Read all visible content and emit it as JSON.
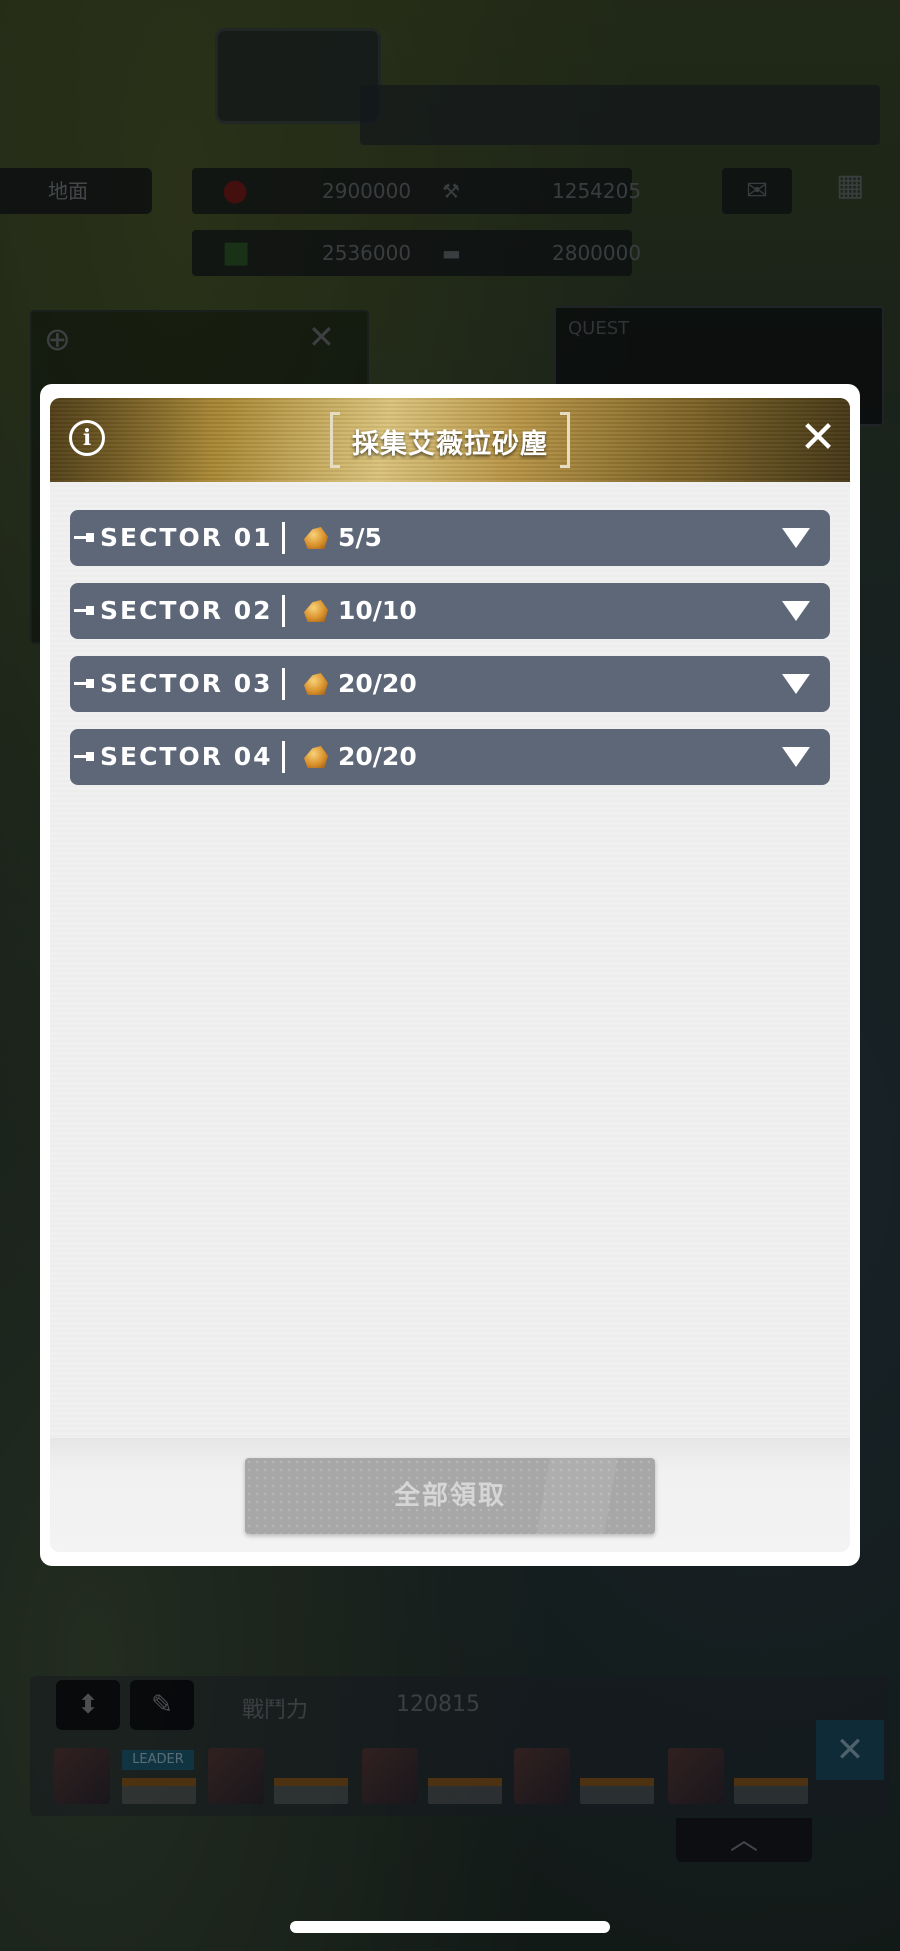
{
  "background": {
    "ground_label": "地面",
    "resources": [
      "2900000",
      "1254205",
      "2536000",
      "2800000"
    ],
    "quest_label": "QUEST",
    "team": {
      "power_label": "戰鬥力",
      "power_value": "120815",
      "leader_tag": "LEADER"
    }
  },
  "modal": {
    "title": "採集艾薇拉砂塵",
    "info_icon": "i",
    "close_icon": "✕",
    "sectors": [
      {
        "name": "SECTOR 01",
        "count": "5/5"
      },
      {
        "name": "SECTOR 02",
        "count": "10/10"
      },
      {
        "name": "SECTOR 03",
        "count": "20/20"
      },
      {
        "name": "SECTOR 04",
        "count": "20/20"
      }
    ],
    "claim_all_label": "全部領取"
  },
  "colors": {
    "sector_row": "#5d6778",
    "header_gold": "#b79445",
    "button_disabled": "#a7a7a7"
  }
}
